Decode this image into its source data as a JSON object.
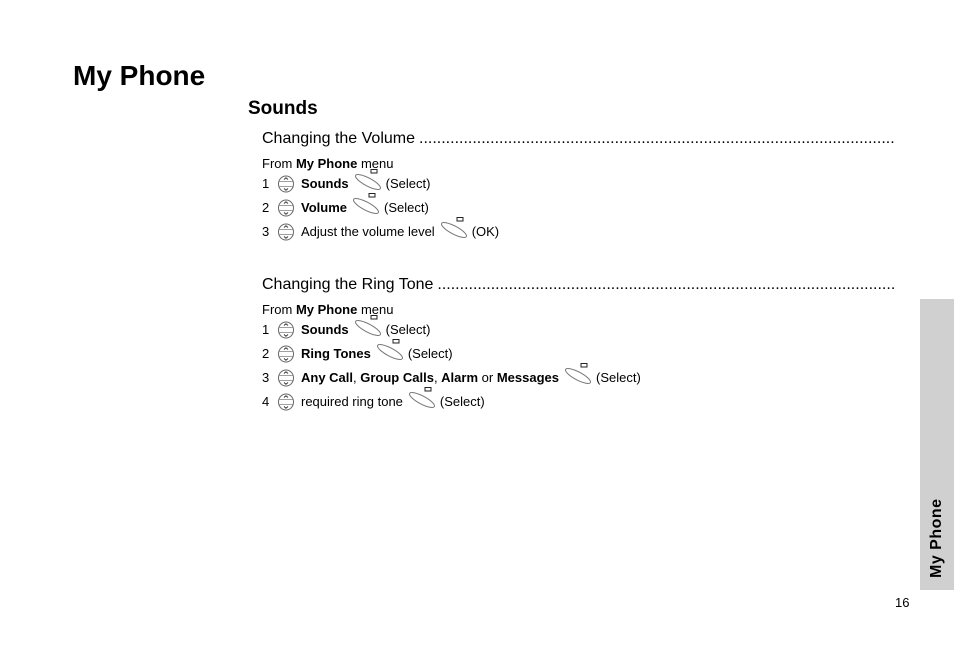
{
  "chapter_title": "My Phone",
  "section_title": "Sounds",
  "procedures": [
    {
      "title": "Changing the Volume",
      "from": {
        "prefix": "From ",
        "menu": "My Phone",
        "suffix": " menu"
      },
      "steps": [
        {
          "num": "1",
          "parts": [
            {
              "text": "Sounds",
              "bold": true
            }
          ],
          "action": "(Select)"
        },
        {
          "num": "2",
          "parts": [
            {
              "text": "Volume",
              "bold": true
            }
          ],
          "action": "(Select)"
        },
        {
          "num": "3",
          "parts": [
            {
              "text": "Adjust the volume level",
              "bold": false
            }
          ],
          "action": "(OK)"
        }
      ]
    },
    {
      "title": "Changing the Ring Tone",
      "from": {
        "prefix": "From ",
        "menu": "My Phone",
        "suffix": " menu"
      },
      "steps": [
        {
          "num": "1",
          "parts": [
            {
              "text": "Sounds",
              "bold": true
            }
          ],
          "action": "(Select)"
        },
        {
          "num": "2",
          "parts": [
            {
              "text": "Ring Tones",
              "bold": true
            }
          ],
          "action": "(Select)"
        },
        {
          "num": "3",
          "parts": [
            {
              "text": "Any Call",
              "bold": true
            },
            {
              "text": ", ",
              "bold": false
            },
            {
              "text": "Group Calls",
              "bold": true
            },
            {
              "text": ", ",
              "bold": false
            },
            {
              "text": "Alarm",
              "bold": true
            },
            {
              "text": " or ",
              "bold": false
            },
            {
              "text": "Messages",
              "bold": true
            }
          ],
          "action": "(Select)"
        },
        {
          "num": "4",
          "parts": [
            {
              "text": "required ring tone",
              "bold": false
            }
          ],
          "action": "(Select)"
        }
      ]
    }
  ],
  "icons": {
    "navigation": "scroll-key-icon",
    "softkey": "softkey-icon"
  },
  "side_tab": {
    "label": "My Phone",
    "color": "#d0d0d0"
  },
  "page_number": "16"
}
